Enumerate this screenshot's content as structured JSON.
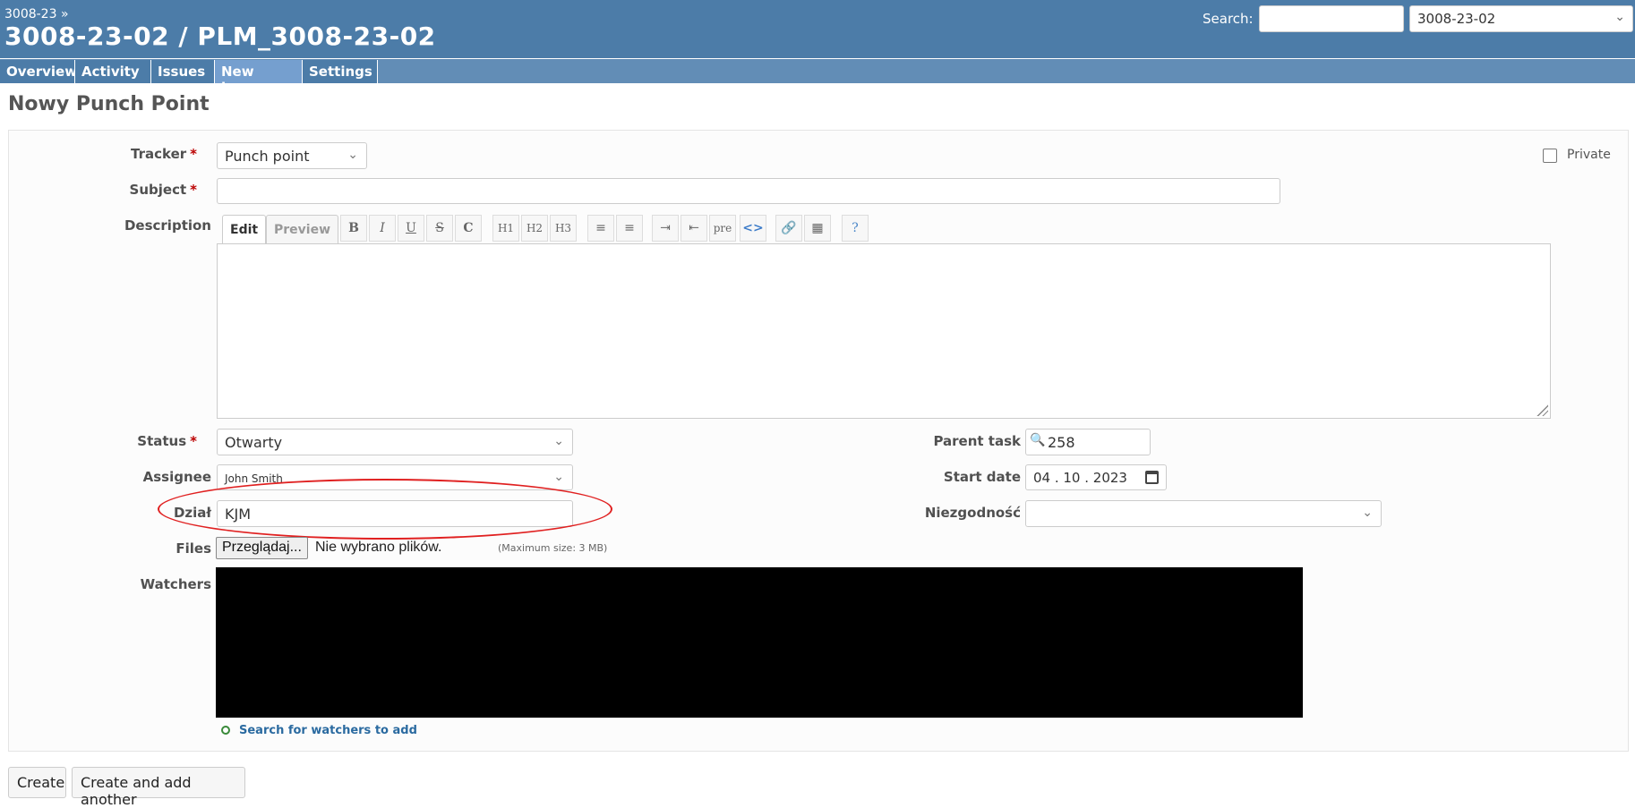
{
  "header": {
    "breadcrumb": "3008-23 »",
    "title": "3008-23-02 / PLM_3008-23-02",
    "search_label": "Search:",
    "search_value": "",
    "project_select": "3008-23-02"
  },
  "menu": {
    "tabs": [
      {
        "label": "Overview"
      },
      {
        "label": "Activity"
      },
      {
        "label": "Issues"
      },
      {
        "label": "New issue",
        "selected": true
      },
      {
        "label": "Settings"
      }
    ]
  },
  "page": {
    "title": "Nowy Punch Point"
  },
  "form": {
    "tracker_label": "Tracker",
    "tracker_value": "Punch point",
    "private_label": "Private",
    "subject_label": "Subject",
    "subject_value": "",
    "description_label": "Description",
    "editor_tabs": {
      "edit": "Edit",
      "preview": "Preview"
    },
    "toolbar": [
      "B",
      "I",
      "U",
      "S",
      "C",
      "H1",
      "H2",
      "H3",
      "ul",
      "ol",
      "indent",
      "outdent",
      "pre",
      "<>",
      "link",
      "img",
      "?"
    ],
    "status_label": "Status",
    "status_value": "Otwarty",
    "assignee_label": "Assignee",
    "assignee_value": "John Smith",
    "dzial_label": "Dział",
    "dzial_value": "KJM",
    "files_label": "Files",
    "files_button": "Przeglądaj...",
    "files_none": "Nie wybrano plików.",
    "files_max": "(Maximum size: 3 MB)",
    "watchers_label": "Watchers",
    "watchers_link": "Search for watchers to add",
    "parent_task_label": "Parent task",
    "parent_task_value": "258",
    "start_date_label": "Start date",
    "start_date_value": "04 . 10 . 2023",
    "niezgodnosc_label": "Niezgodność",
    "niezgodnosc_value": ""
  },
  "actions": {
    "create": "Create",
    "create_another": "Create and add another"
  },
  "colors": {
    "header_bg": "#4c7ca8",
    "menu_bg": "#628db6",
    "required": "#bb0000",
    "annotation": "#e02020"
  }
}
